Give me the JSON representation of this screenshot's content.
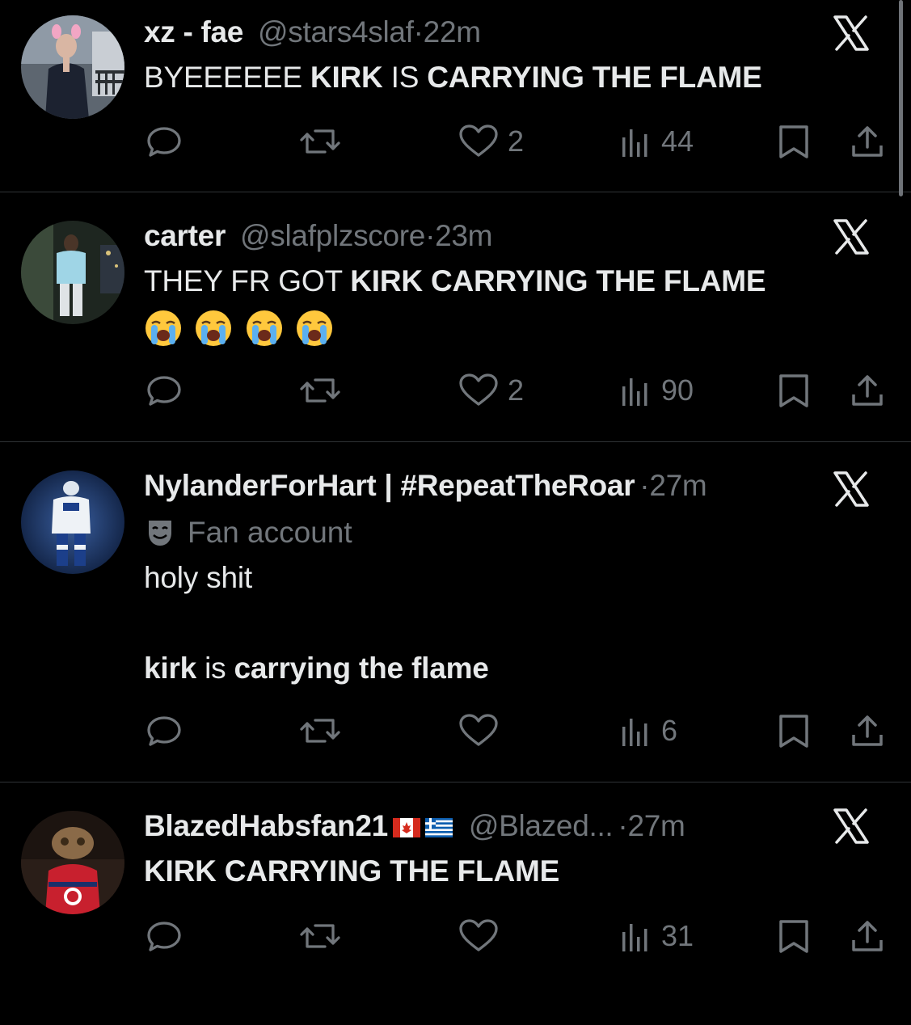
{
  "tweets": [
    {
      "name": "xz - fae",
      "handle": "@stars4slaf",
      "time": "22m",
      "text_parts": [
        "BYEEEEEE ",
        "KIRK",
        " IS ",
        "CARRYING THE FLAME"
      ],
      "reply_count": "",
      "retweet_count": "",
      "like_count": "2",
      "view_count": "44"
    },
    {
      "name": "carter",
      "handle": "@slafplzscore",
      "time": "23m",
      "text_parts": [
        "THEY FR GOT ",
        "KIRK CARRYING THE FLAME"
      ],
      "emoji_count": 4,
      "like_count": "2",
      "view_count": "90"
    },
    {
      "name": "NylanderForHart | #RepeatTheRoar",
      "handle": "",
      "time": "27m",
      "badge": "Fan account",
      "line1": "holy shit",
      "text_parts": [
        "kirk",
        " is ",
        "carrying the flame"
      ],
      "like_count": "",
      "view_count": "6"
    },
    {
      "name": "BlazedHabsfan21",
      "flags": [
        "canada-flag",
        "greece-flag"
      ],
      "handle": "@Blazed...",
      "time": "27m",
      "text_parts": [
        "KIRK CARRYING THE FLAME"
      ],
      "like_count": "",
      "view_count": "31"
    }
  ],
  "separator": "·",
  "icons": {
    "reply": "reply-icon",
    "retweet": "retweet-icon",
    "like": "like-icon",
    "views": "views-icon",
    "bookmark": "bookmark-icon",
    "share": "share-icon",
    "brand": "x-logo-icon",
    "emoji": "loudly-crying-face-emoji",
    "badge": "theater-mask-icon"
  },
  "colors": {
    "background": "#000000",
    "text": "#e7e9ea",
    "muted": "#71767b",
    "divider": "#2f3336"
  }
}
